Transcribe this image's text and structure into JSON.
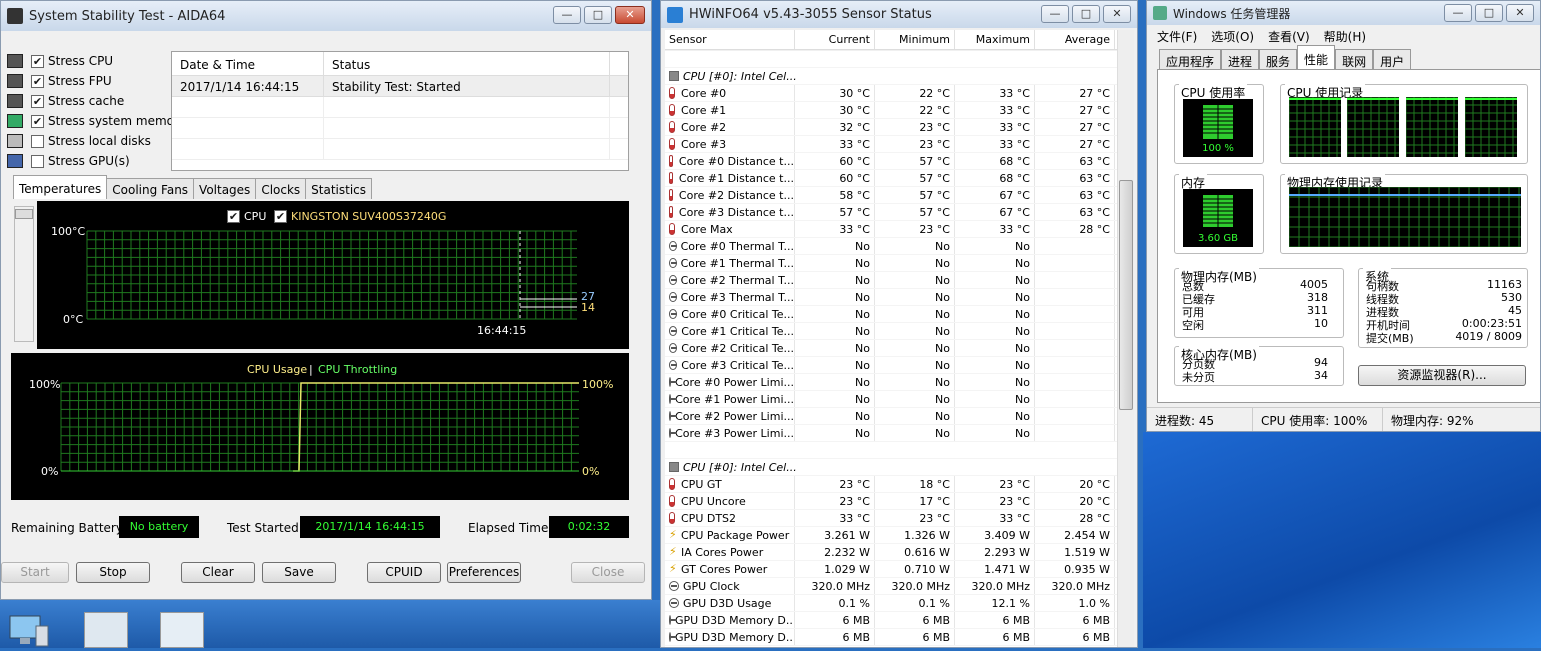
{
  "aida": {
    "title": "System Stability Test - AIDA64",
    "window_buttons": [
      "—",
      "□",
      "✕"
    ],
    "stress_items": [
      {
        "label": "Stress CPU",
        "checked": true
      },
      {
        "label": "Stress FPU",
        "checked": true
      },
      {
        "label": "Stress cache",
        "checked": true
      },
      {
        "label": "Stress system memory",
        "checked": true
      },
      {
        "label": "Stress local disks",
        "checked": false
      },
      {
        "label": "Stress GPU(s)",
        "checked": false
      }
    ],
    "log": {
      "headers": [
        "Date & Time",
        "Status"
      ],
      "rows": [
        [
          "2017/1/14 16:44:15",
          "Stability Test: Started"
        ]
      ]
    },
    "tabs": [
      "Temperatures",
      "Cooling Fans",
      "Voltages",
      "Clocks",
      "Statistics"
    ],
    "temp_graph": {
      "legend_cpu": "CPU",
      "legend_disk": "KINGSTON SUV400S37240G",
      "y_top": "100°C",
      "y_bottom": "0°C",
      "time_label": "16:44:15",
      "val_cpu": "27",
      "val_disk": "14"
    },
    "usage_graph": {
      "title_usage": "CPU Usage",
      "separator": "|",
      "title_throttle": "CPU Throttling",
      "y_top_left": "100%",
      "y_bottom_left": "0%",
      "y_top_right": "100%",
      "y_bottom_right": "0%"
    },
    "remaining_battery_label": "Remaining Battery:",
    "remaining_battery_value": "No battery",
    "test_started_label": "Test Started:",
    "test_started_value": "2017/1/14 16:44:15",
    "elapsed_label": "Elapsed Time:",
    "elapsed_value": "0:02:32",
    "buttons": {
      "start": "Start",
      "stop": "Stop",
      "clear": "Clear",
      "save": "Save",
      "cpuid": "CPUID",
      "preferences": "Preferences",
      "close": "Close"
    }
  },
  "hwinfo": {
    "title": "HWiNFO64 v5.43-3055 Sensor Status",
    "window_buttons": [
      "—",
      "□",
      "✕"
    ],
    "headers": [
      "Sensor",
      "Current",
      "Minimum",
      "Maximum",
      "Average"
    ],
    "groups": [
      {
        "name": "CPU [#0]: Intel Cel...",
        "rows": [
          {
            "icon": "temp",
            "name": "Core #0",
            "cur": "30 °C",
            "min": "22 °C",
            "max": "33 °C",
            "avg": "27 °C"
          },
          {
            "icon": "temp",
            "name": "Core #1",
            "cur": "30 °C",
            "min": "22 °C",
            "max": "33 °C",
            "avg": "27 °C"
          },
          {
            "icon": "temp",
            "name": "Core #2",
            "cur": "32 °C",
            "min": "23 °C",
            "max": "33 °C",
            "avg": "27 °C"
          },
          {
            "icon": "temp",
            "name": "Core #3",
            "cur": "33 °C",
            "min": "23 °C",
            "max": "33 °C",
            "avg": "27 °C"
          },
          {
            "icon": "temp",
            "name": "Core #0 Distance t...",
            "cur": "60 °C",
            "min": "57 °C",
            "max": "68 °C",
            "avg": "63 °C"
          },
          {
            "icon": "temp",
            "name": "Core #1 Distance t...",
            "cur": "60 °C",
            "min": "57 °C",
            "max": "68 °C",
            "avg": "63 °C"
          },
          {
            "icon": "temp",
            "name": "Core #2 Distance t...",
            "cur": "58 °C",
            "min": "57 °C",
            "max": "67 °C",
            "avg": "63 °C"
          },
          {
            "icon": "temp",
            "name": "Core #3 Distance t...",
            "cur": "57 °C",
            "min": "57 °C",
            "max": "67 °C",
            "avg": "63 °C"
          },
          {
            "icon": "temp",
            "name": "Core Max",
            "cur": "33 °C",
            "min": "23 °C",
            "max": "33 °C",
            "avg": "28 °C"
          },
          {
            "icon": "circle",
            "name": "Core #0 Thermal T...",
            "cur": "No",
            "min": "No",
            "max": "No",
            "avg": ""
          },
          {
            "icon": "circle",
            "name": "Core #1 Thermal T...",
            "cur": "No",
            "min": "No",
            "max": "No",
            "avg": ""
          },
          {
            "icon": "circle",
            "name": "Core #2 Thermal T...",
            "cur": "No",
            "min": "No",
            "max": "No",
            "avg": ""
          },
          {
            "icon": "circle",
            "name": "Core #3 Thermal T...",
            "cur": "No",
            "min": "No",
            "max": "No",
            "avg": ""
          },
          {
            "icon": "circle",
            "name": "Core #0 Critical Te...",
            "cur": "No",
            "min": "No",
            "max": "No",
            "avg": ""
          },
          {
            "icon": "circle",
            "name": "Core #1 Critical Te...",
            "cur": "No",
            "min": "No",
            "max": "No",
            "avg": ""
          },
          {
            "icon": "circle",
            "name": "Core #2 Critical Te...",
            "cur": "No",
            "min": "No",
            "max": "No",
            "avg": ""
          },
          {
            "icon": "circle",
            "name": "Core #3 Critical Te...",
            "cur": "No",
            "min": "No",
            "max": "No",
            "avg": ""
          },
          {
            "icon": "circle",
            "name": "Core #0 Power Limi...",
            "cur": "No",
            "min": "No",
            "max": "No",
            "avg": ""
          },
          {
            "icon": "circle",
            "name": "Core #1 Power Limi...",
            "cur": "No",
            "min": "No",
            "max": "No",
            "avg": ""
          },
          {
            "icon": "circle",
            "name": "Core #2 Power Limi...",
            "cur": "No",
            "min": "No",
            "max": "No",
            "avg": ""
          },
          {
            "icon": "circle",
            "name": "Core #3 Power Limi...",
            "cur": "No",
            "min": "No",
            "max": "No",
            "avg": ""
          }
        ]
      },
      {
        "name": "CPU [#0]: Intel Cel...",
        "rows": [
          {
            "icon": "temp",
            "name": "CPU GT",
            "cur": "23 °C",
            "min": "18 °C",
            "max": "23 °C",
            "avg": "20 °C"
          },
          {
            "icon": "temp",
            "name": "CPU Uncore",
            "cur": "23 °C",
            "min": "17 °C",
            "max": "23 °C",
            "avg": "20 °C"
          },
          {
            "icon": "temp",
            "name": "CPU DTS2",
            "cur": "33 °C",
            "min": "23 °C",
            "max": "33 °C",
            "avg": "28 °C"
          },
          {
            "icon": "bolt",
            "name": "CPU Package Power",
            "cur": "3.261 W",
            "min": "1.326 W",
            "max": "3.409 W",
            "avg": "2.454 W"
          },
          {
            "icon": "bolt",
            "name": "IA Cores Power",
            "cur": "2.232 W",
            "min": "0.616 W",
            "max": "2.293 W",
            "avg": "1.519 W"
          },
          {
            "icon": "bolt",
            "name": "GT Cores Power",
            "cur": "1.029 W",
            "min": "0.710 W",
            "max": "1.471 W",
            "avg": "0.935 W"
          },
          {
            "icon": "circle",
            "name": "GPU Clock",
            "cur": "320.0 MHz",
            "min": "320.0 MHz",
            "max": "320.0 MHz",
            "avg": "320.0 MHz"
          },
          {
            "icon": "circle",
            "name": "GPU D3D Usage",
            "cur": "0.1 %",
            "min": "0.1 %",
            "max": "12.1 %",
            "avg": "1.0 %"
          },
          {
            "icon": "circle",
            "name": "GPU D3D Memory D...",
            "cur": "6 MB",
            "min": "6 MB",
            "max": "6 MB",
            "avg": "6 MB"
          },
          {
            "icon": "circle",
            "name": "GPU D3D Memory D...",
            "cur": "6 MB",
            "min": "6 MB",
            "max": "6 MB",
            "avg": "6 MB"
          }
        ]
      }
    ]
  },
  "taskmgr": {
    "title": "Windows 任务管理器",
    "window_buttons": [
      "—",
      "□",
      "✕"
    ],
    "menu": [
      "文件(F)",
      "选项(O)",
      "查看(V)",
      "帮助(H)"
    ],
    "tabs": [
      "应用程序",
      "进程",
      "服务",
      "性能",
      "联网",
      "用户"
    ],
    "cpu_usage_label": "CPU 使用率",
    "cpu_usage_value": "100 %",
    "cpu_history_label": "CPU 使用记录",
    "mem_label": "内存",
    "mem_value": "3.60 GB",
    "mem_history_label": "物理内存使用记录",
    "physical": {
      "title": "物理内存(MB)",
      "rows": [
        [
          "总数",
          "4005"
        ],
        [
          "已缓存",
          "318"
        ],
        [
          "可用",
          "311"
        ],
        [
          "空闲",
          "10"
        ]
      ]
    },
    "kernel": {
      "title": "核心内存(MB)",
      "rows": [
        [
          "分页数",
          "94"
        ],
        [
          "未分页",
          "34"
        ]
      ]
    },
    "system": {
      "title": "系统",
      "rows": [
        [
          "句柄数",
          "11163"
        ],
        [
          "线程数",
          "530"
        ],
        [
          "进程数",
          "45"
        ],
        [
          "开机时间",
          "0:00:23:51"
        ],
        [
          "提交(MB)",
          "4019 / 8009"
        ]
      ]
    },
    "resource_monitor_button": "资源监视器(R)...",
    "status": [
      "进程数: 45",
      "CPU 使用率: 100%",
      "物理内存: 92%"
    ]
  }
}
